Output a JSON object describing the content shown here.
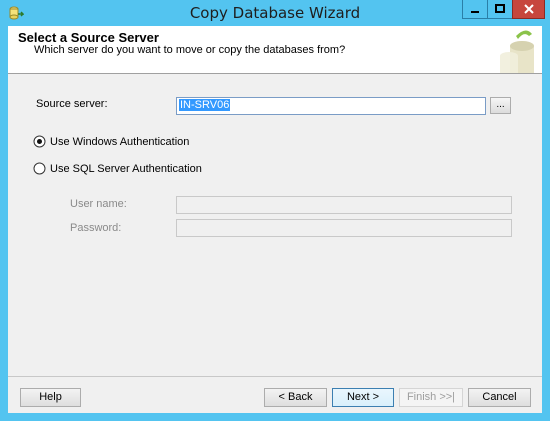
{
  "window": {
    "title": "Copy Database Wizard"
  },
  "header": {
    "title": "Select a Source Server",
    "subtitle": "Which server do you want to move or copy the databases from?"
  },
  "form": {
    "source_server_label": "Source server:",
    "source_server_value": "IN-SRV06",
    "browse_label": "...",
    "windows_auth_label": "Use Windows Authentication",
    "windows_auth_selected": true,
    "sql_auth_label": "Use SQL Server Authentication",
    "sql_auth_selected": false,
    "username_label": "User name:",
    "username_value": "",
    "password_label": "Password:",
    "password_value": ""
  },
  "buttons": {
    "help": "Help",
    "back": "< Back",
    "next": "Next >",
    "finish": "Finish >>|",
    "cancel": "Cancel"
  }
}
